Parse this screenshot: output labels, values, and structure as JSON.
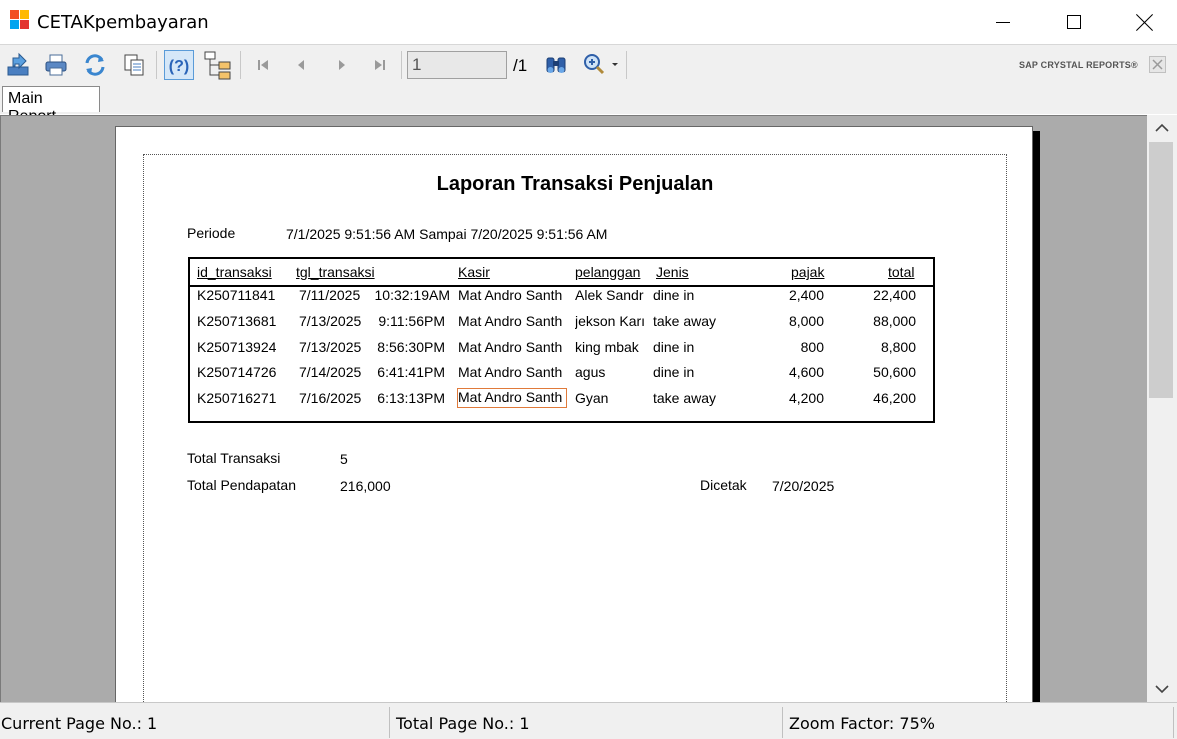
{
  "window": {
    "title": "CETAKpembayaran"
  },
  "toolbar": {
    "export_icon": "export-icon",
    "print_icon": "print-icon",
    "refresh_icon": "refresh-icon",
    "copy_icon": "copy-icon",
    "help_icon": "help-icon",
    "group_tree_icon": "group-tree-icon",
    "first_page_icon": "first-page-icon",
    "prev_page_icon": "previous-page-icon",
    "next_page_icon": "next-page-icon",
    "last_page_icon": "last-page-icon",
    "page_value": "1",
    "page_total": "/1",
    "find_icon": "binoculars-icon",
    "zoom_icon": "zoom-icon",
    "brand": "SAP CRYSTAL REPORTS®"
  },
  "tabs": [
    {
      "label": "Main Report"
    }
  ],
  "report": {
    "title": "Laporan Transaksi Penjualan",
    "periode_label": "Periode",
    "periode_value": "7/1/2025 9:51:56 AM Sampai 7/20/2025 9:51:56 AM",
    "columns": [
      "id_transaksi",
      "tgl_transaksi",
      "Kasir",
      "pelanggan",
      "Jenis",
      "pajak",
      "total"
    ],
    "rows": [
      {
        "id": "K250711841",
        "date": "7/11/2025",
        "time": "10:32:19AM",
        "kasir": "Mat Andro Santh",
        "pelanggan": "Alek Sandr",
        "jenis": "dine in",
        "pajak": "2,400",
        "total": "22,400"
      },
      {
        "id": "K250713681",
        "date": "7/13/2025",
        "time": "9:11:56PM",
        "kasir": "Mat Andro Santh",
        "pelanggan": "jekson Karı",
        "jenis": "take away",
        "pajak": "8,000",
        "total": "88,000"
      },
      {
        "id": "K250713924",
        "date": "7/13/2025",
        "time": "8:56:30PM",
        "kasir": "Mat Andro Santh",
        "pelanggan": "king mbak",
        "jenis": "dine in",
        "pajak": "800",
        "total": "8,800"
      },
      {
        "id": "K250714726",
        "date": "7/14/2025",
        "time": "6:41:41PM",
        "kasir": "Mat Andro Santh",
        "pelanggan": "agus",
        "jenis": "dine in",
        "pajak": "4,600",
        "total": "50,600"
      },
      {
        "id": "K250716271",
        "date": "7/16/2025",
        "time": "6:13:13PM",
        "kasir": "Mat Andro Santh",
        "pelanggan": "Gyan",
        "jenis": "take away",
        "pajak": "4,200",
        "total": "46,200"
      }
    ],
    "total_transaksi_label": "Total Transaksi",
    "total_transaksi_value": "5",
    "total_pendapatan_label": "Total Pendapatan",
    "total_pendapatan_value": "216,000",
    "dicetak_label": "Dicetak",
    "dicetak_value": "7/20/2025"
  },
  "status": {
    "current_page": "Current Page No.: 1",
    "total_page": "Total Page No.: 1",
    "zoom": "Zoom Factor: 75%"
  }
}
